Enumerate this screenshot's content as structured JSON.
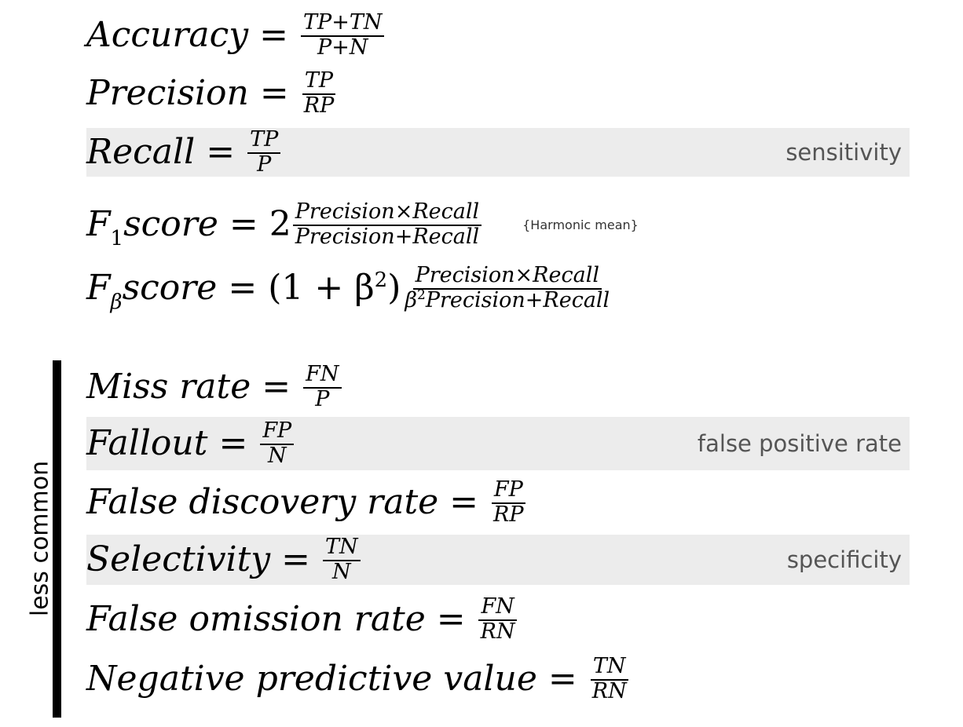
{
  "formulas": {
    "accuracy": {
      "lhs": "Accuracy",
      "num": "TP+TN",
      "den": "P+N"
    },
    "precision": {
      "lhs": "Precision",
      "num": "TP",
      "den": "RP"
    },
    "recall": {
      "lhs": "Recall",
      "num": "TP",
      "den": "P",
      "note": "sensitivity"
    },
    "f1": {
      "lhs_main": "F",
      "lhs_sub": "1",
      "lhs_rest": "score",
      "coef": "2",
      "num": "Precision×Recall",
      "den": "Precision+Recall",
      "note": "{Harmonic mean}"
    },
    "fbeta": {
      "lhs_main": "F",
      "lhs_sub": "β",
      "lhs_rest": "score",
      "coef_open": "(1 + β",
      "coef_sup": "2",
      "coef_close": ")",
      "num": "Precision×Recall",
      "den_beta": "β",
      "den_sup": "2",
      "den_rest": "Precision+Recall"
    }
  },
  "less_common": {
    "label": "less common",
    "miss_rate": {
      "lhs": "Miss rate",
      "num": "FN",
      "den": "P"
    },
    "fallout": {
      "lhs": "Fallout",
      "num": "FP",
      "den": "N",
      "note": "false positive rate"
    },
    "fdr": {
      "lhs": "False discovery rate",
      "num": "FP",
      "den": "RP"
    },
    "selectivity": {
      "lhs": "Selectivity",
      "num": "TN",
      "den": "N",
      "note": "specificity"
    },
    "for": {
      "lhs": "False omission rate",
      "num": "FN",
      "den": "RN"
    },
    "npv": {
      "lhs": "Negative predictive value",
      "num": "TN",
      "den": "RN"
    }
  },
  "symbols": {
    "equals": "="
  }
}
